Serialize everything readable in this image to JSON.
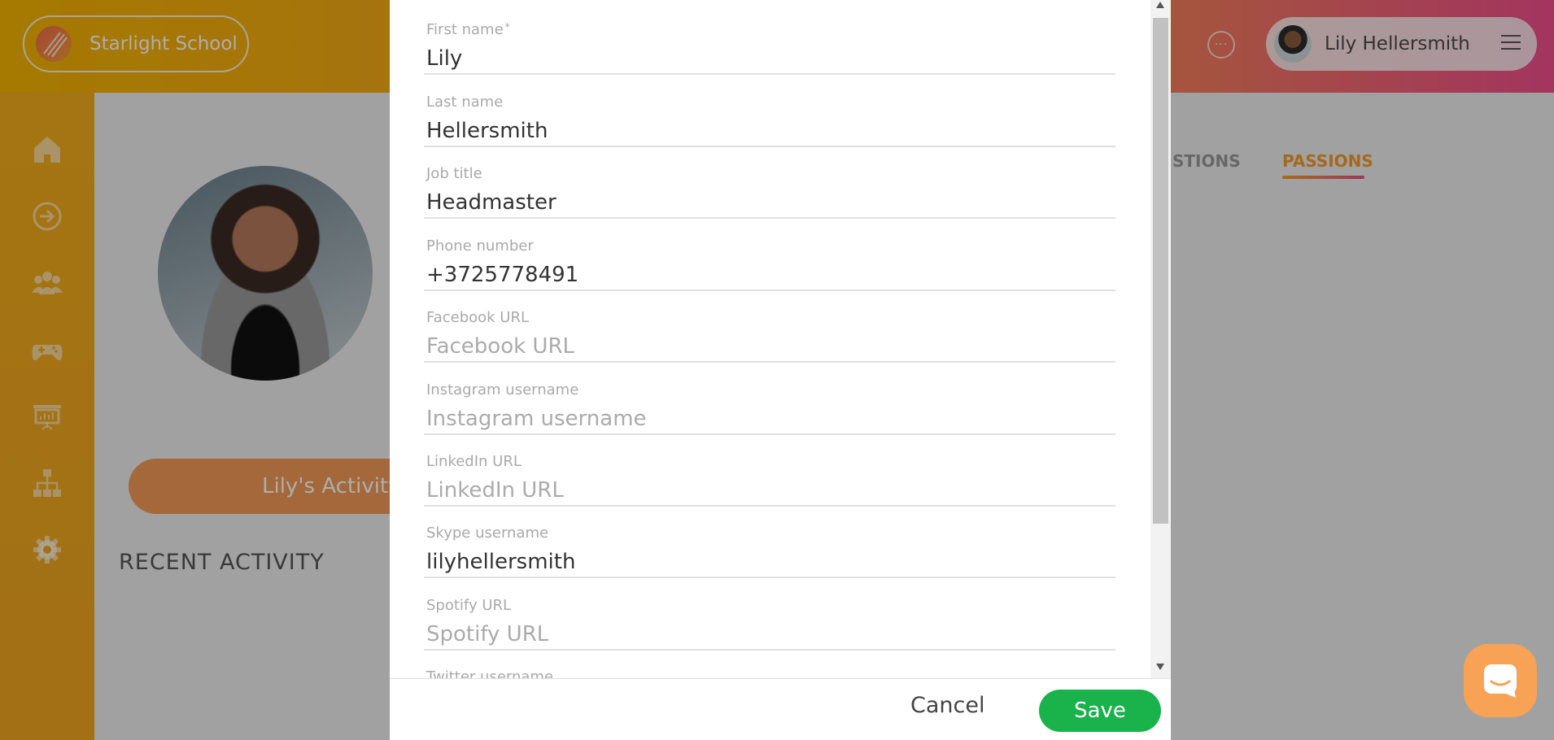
{
  "header": {
    "school_name": "Starlight School",
    "user_name": "Lily Hellersmith",
    "more_icon": "ellipsis-circle-icon",
    "menu_icon": "hamburger-icon"
  },
  "sidebar": {
    "items": [
      {
        "icon": "home-icon"
      },
      {
        "icon": "sign-in-icon"
      },
      {
        "icon": "users-icon"
      },
      {
        "icon": "gamepad-icon"
      },
      {
        "icon": "presentation-icon"
      },
      {
        "icon": "org-chart-icon"
      },
      {
        "icon": "gear-icon"
      }
    ]
  },
  "profile": {
    "activity_button": "Lily's Activity",
    "recent_activity_title": "RECENT ACTIVITY",
    "tabs": [
      {
        "label": "STIONS"
      },
      {
        "label": "PASSIONS",
        "active": true
      }
    ]
  },
  "modal": {
    "fields": [
      {
        "label": "First name",
        "required": "*",
        "value": "Lily",
        "placeholder": ""
      },
      {
        "label": "Last name",
        "value": "Hellersmith",
        "placeholder": ""
      },
      {
        "label": "Job title",
        "value": "Headmaster",
        "placeholder": ""
      },
      {
        "label": "Phone number",
        "value": "+3725778491",
        "placeholder": ""
      },
      {
        "label": "Facebook URL",
        "value": "",
        "placeholder": "Facebook URL"
      },
      {
        "label": "Instagram username",
        "value": "",
        "placeholder": "Instagram username"
      },
      {
        "label": "LinkedIn URL",
        "value": "",
        "placeholder": "LinkedIn URL"
      },
      {
        "label": "Skype username",
        "value": "lilyhellersmith",
        "placeholder": ""
      },
      {
        "label": "Spotify URL",
        "value": "",
        "placeholder": "Spotify URL"
      },
      {
        "label": "Twitter username",
        "value": "",
        "placeholder": ""
      }
    ],
    "cancel_label": "Cancel",
    "save_label": "Save"
  },
  "colors": {
    "accent": "#f6a623",
    "save": "#19b24b",
    "tab_active": "#f59a2a"
  }
}
